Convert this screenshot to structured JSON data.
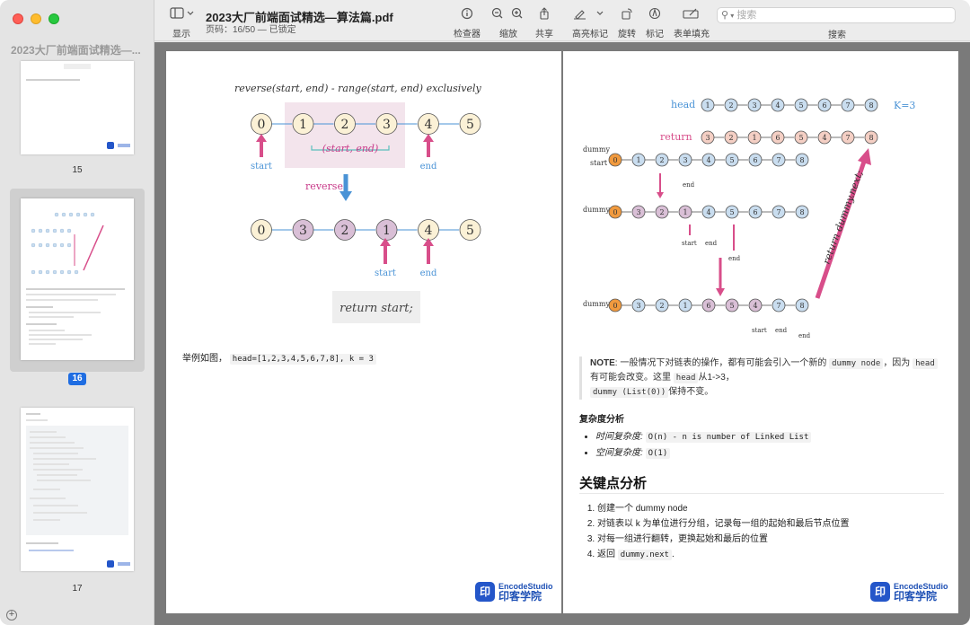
{
  "window": {
    "sidebar_title": "2023大厂前端面试精选—...",
    "doc_title": "2023大厂前端面试精选—算法篇.pdf",
    "doc_subtitle": "页码：16/50 — 已锁定",
    "toolbar": {
      "display": "显示",
      "inspector": "检查器",
      "zoom": "缩放",
      "share": "共享",
      "highlight": "高亮标记",
      "rotate": "旋转",
      "markup": "标记",
      "form_fill": "表单填充",
      "search_label": "搜索",
      "search_placeholder": "搜索"
    },
    "icons": [
      "sidebar-icon",
      "chevron-down-icon",
      "info-icon",
      "zoom-out-icon",
      "zoom-in-icon",
      "share-icon",
      "pen-icon",
      "rotate-icon",
      "markup-icon",
      "form-icon",
      "search-icon",
      "add-icon"
    ]
  },
  "sidebar": {
    "thumbnails": [
      {
        "label": "15"
      },
      {
        "label": "16",
        "selected": true
      },
      {
        "label": "17"
      }
    ]
  },
  "left_page": {
    "diagram1_caption": "reverse(start, end) - range(start, end) exclusively",
    "nodes_top": [
      "0",
      "1",
      "2",
      "3",
      "4",
      "5"
    ],
    "range_label": "(start, end)",
    "start_label": "start",
    "end_label": "end",
    "reverse_label": "reverse",
    "nodes_bottom": [
      "0",
      "3",
      "2",
      "1",
      "4",
      "5"
    ],
    "return_label": "return start;",
    "example_text": "举例如图，",
    "example_code": "head=[1,2,3,4,5,6,7,8], k = 3",
    "brand_en": "EncodeStudio",
    "brand_cn": "印客学院"
  },
  "right_page": {
    "head_label": "head",
    "k_label": "K=3",
    "head_nodes": [
      "1",
      "2",
      "3",
      "4",
      "5",
      "6",
      "7",
      "8"
    ],
    "return_label": "return",
    "return_nodes": [
      "3",
      "2",
      "1",
      "6",
      "5",
      "4",
      "7",
      "8"
    ],
    "dummy_label": "dummy",
    "start_label": "start",
    "end_label": "end",
    "row1_nodes": [
      "0",
      "1",
      "2",
      "3",
      "4",
      "5",
      "6",
      "7",
      "8"
    ],
    "row2_nodes": [
      "0",
      "3",
      "2",
      "1",
      "4",
      "5",
      "6",
      "7",
      "8"
    ],
    "row3_nodes": [
      "0",
      "3",
      "2",
      "1",
      "6",
      "5",
      "4",
      "7",
      "8"
    ],
    "diag_return": "return dummy.next;",
    "note_bold": "NOTE",
    "note_text1": ": 一般情况下对链表的操作，都有可能会引入一个新的",
    "note_code1": "dummy node",
    "note_text2": "，因为",
    "note_code2": "head",
    "note_text3": "有可能会改变。这里",
    "note_code3": "head",
    "note_text4": "从1->3，",
    "note_code4": "dummy (List(0))",
    "note_text5": "保持不变。",
    "complexity_title": "复杂度分析",
    "time_label": "时间复杂度:",
    "time_code": "O(n) - n is number of Linked List",
    "space_label": "空间复杂度:",
    "space_code": "O(1)",
    "key_title": "关键点分析",
    "key_items": [
      "创建一个 dummy node",
      "对链表以 k 为单位进行分组，记录每一组的起始和最后节点位置",
      "对每一组进行翻转，更换起始和最后的位置"
    ],
    "key_item4_text": "返回",
    "key_item4_code": "dummy.next",
    "key_item4_end": ".",
    "brand_en": "EncodeStudio",
    "brand_cn": "印客学院"
  },
  "colors": {
    "node_fill": "#fbf1d6",
    "node_purple": "#d9bfd6",
    "node_blue": "#c9ddef",
    "node_orange": "#f19a3e",
    "node_pink": "#f4cfc4",
    "pink": "#d84e8a",
    "arrow_blue": "#4a93d6",
    "accent": "#1f6de2"
  }
}
